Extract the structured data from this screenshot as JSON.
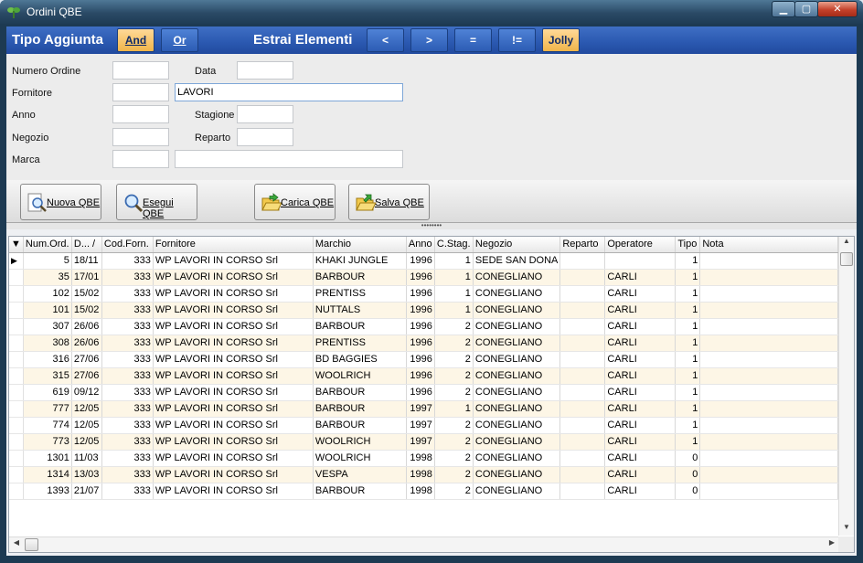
{
  "window": {
    "title": "Ordini QBE",
    "min_label": "▁",
    "max_label": "▢",
    "close_label": "✕"
  },
  "toolbar": {
    "tipo_label": "Tipo Aggiunta",
    "and_label": "And",
    "or_label": "Or",
    "estrai_label": "Estrai Elementi",
    "lt_label": "<",
    "gt_label": ">",
    "eq_label": "=",
    "neq_label": "!=",
    "jolly_label": "Jolly"
  },
  "form": {
    "numero_ordine": {
      "label": "Numero Ordine",
      "value": ""
    },
    "data": {
      "label": "Data",
      "value": ""
    },
    "fornitore": {
      "label": "Fornitore",
      "code": "",
      "name": "LAVORI"
    },
    "anno": {
      "label": "Anno",
      "value": ""
    },
    "stagione": {
      "label": "Stagione",
      "value": ""
    },
    "negozio": {
      "label": "Negozio",
      "value": ""
    },
    "reparto": {
      "label": "Reparto",
      "value": ""
    },
    "marca": {
      "label": "Marca",
      "code": "",
      "name": ""
    }
  },
  "actions": {
    "nuova": "Nuova QBE",
    "esegui": "Esegui QBE",
    "carica": "Carica QBE",
    "salva": "Salva QBE"
  },
  "splitter": "••••••••",
  "grid": {
    "columns": [
      "Num.Ord.",
      "D... /",
      "Cod.Forn.",
      "Fornitore",
      "Marchio",
      "Anno",
      "C.Stag.",
      "Negozio",
      "Reparto",
      "Operatore",
      "Tipo",
      "Nota"
    ],
    "sort_indicator": "▼",
    "current_row_marker": "▶",
    "rows": [
      [
        "5",
        "18/11",
        "333",
        "WP LAVORI IN CORSO Srl",
        "KHAKI JUNGLE",
        "1996",
        "1",
        "SEDE SAN DONA",
        "",
        "",
        "1",
        ""
      ],
      [
        "35",
        "17/01",
        "333",
        "WP LAVORI IN CORSO Srl",
        "BARBOUR",
        "1996",
        "1",
        "CONEGLIANO",
        "",
        "CARLI",
        "1",
        ""
      ],
      [
        "102",
        "15/02",
        "333",
        "WP LAVORI IN CORSO Srl",
        "PRENTISS",
        "1996",
        "1",
        "CONEGLIANO",
        "",
        "CARLI",
        "1",
        ""
      ],
      [
        "101",
        "15/02",
        "333",
        "WP LAVORI IN CORSO Srl",
        "NUTTALS",
        "1996",
        "1",
        "CONEGLIANO",
        "",
        "CARLI",
        "1",
        ""
      ],
      [
        "307",
        "26/06",
        "333",
        "WP LAVORI IN CORSO Srl",
        "BARBOUR",
        "1996",
        "2",
        "CONEGLIANO",
        "",
        "CARLI",
        "1",
        ""
      ],
      [
        "308",
        "26/06",
        "333",
        "WP LAVORI IN CORSO Srl",
        "PRENTISS",
        "1996",
        "2",
        "CONEGLIANO",
        "",
        "CARLI",
        "1",
        ""
      ],
      [
        "316",
        "27/06",
        "333",
        "WP LAVORI IN CORSO Srl",
        "BD BAGGIES",
        "1996",
        "2",
        "CONEGLIANO",
        "",
        "CARLI",
        "1",
        ""
      ],
      [
        "315",
        "27/06",
        "333",
        "WP LAVORI IN CORSO Srl",
        "WOOLRICH",
        "1996",
        "2",
        "CONEGLIANO",
        "",
        "CARLI",
        "1",
        ""
      ],
      [
        "619",
        "09/12",
        "333",
        "WP LAVORI IN CORSO Srl",
        "BARBOUR",
        "1996",
        "2",
        "CONEGLIANO",
        "",
        "CARLI",
        "1",
        ""
      ],
      [
        "777",
        "12/05",
        "333",
        "WP LAVORI IN CORSO Srl",
        "BARBOUR",
        "1997",
        "1",
        "CONEGLIANO",
        "",
        "CARLI",
        "1",
        ""
      ],
      [
        "774",
        "12/05",
        "333",
        "WP LAVORI IN CORSO Srl",
        "BARBOUR",
        "1997",
        "2",
        "CONEGLIANO",
        "",
        "CARLI",
        "1",
        ""
      ],
      [
        "773",
        "12/05",
        "333",
        "WP LAVORI IN CORSO Srl",
        "WOOLRICH",
        "1997",
        "2",
        "CONEGLIANO",
        "",
        "CARLI",
        "1",
        ""
      ],
      [
        "1301",
        "11/03",
        "333",
        "WP LAVORI IN CORSO Srl",
        "WOOLRICH",
        "1998",
        "2",
        "CONEGLIANO",
        "",
        "CARLI",
        "0",
        ""
      ],
      [
        "1314",
        "13/03",
        "333",
        "WP LAVORI IN CORSO Srl",
        "VESPA",
        "1998",
        "2",
        "CONEGLIANO",
        "",
        "CARLI",
        "0",
        ""
      ],
      [
        "1393",
        "21/07",
        "333",
        "WP LAVORI IN CORSO Srl",
        "BARBOUR",
        "1998",
        "2",
        "CONEGLIANO",
        "",
        "CARLI",
        "0",
        ""
      ]
    ]
  },
  "scroll": {
    "up": "▲",
    "down": "▼",
    "left": "◀",
    "right": "▶"
  },
  "colors": {
    "toolbar_blue": "#2a58b0",
    "selected_button": "#f0b54a",
    "alt_row": "#fdf6e6"
  }
}
